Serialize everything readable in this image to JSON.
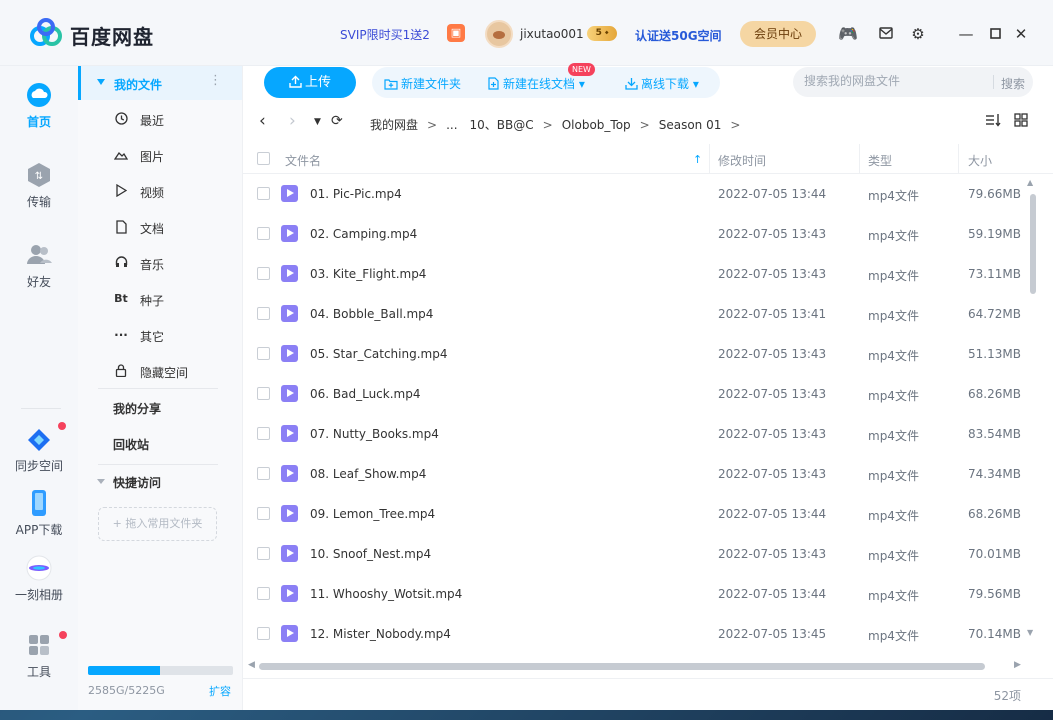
{
  "app": {
    "brand": "百度网盘"
  },
  "titlebar": {
    "promo": "SVIP限时买1送2",
    "username": "jixutao001",
    "vip_badge": "5",
    "verify": "认证送50G空间",
    "member_center": "会员中心"
  },
  "leftnav": {
    "items": [
      {
        "label": "首页",
        "icon": "home-cloud-icon"
      },
      {
        "label": "传输",
        "icon": "transfer-icon"
      },
      {
        "label": "好友",
        "icon": "friends-icon"
      },
      {
        "label": "同步空间",
        "icon": "sync-space-icon"
      },
      {
        "label": "APP下载",
        "icon": "phone-icon"
      },
      {
        "label": "一刻相册",
        "icon": "album-icon"
      },
      {
        "label": "工具",
        "icon": "tools-icon"
      }
    ]
  },
  "sidebar": {
    "my_files": "我的文件",
    "items": [
      {
        "label": "最近",
        "icon": "clock-icon"
      },
      {
        "label": "图片",
        "icon": "image-icon"
      },
      {
        "label": "视频",
        "icon": "play-icon"
      },
      {
        "label": "文档",
        "icon": "document-icon"
      },
      {
        "label": "音乐",
        "icon": "headphones-icon"
      },
      {
        "label": "种子",
        "icon": "torrent-icon"
      },
      {
        "label": "其它",
        "icon": "more-icon"
      },
      {
        "label": "隐藏空间",
        "icon": "lock-icon"
      }
    ],
    "my_share": "我的分享",
    "recycle": "回收站",
    "quick_access": "快捷访问",
    "drag_hint": "+ 拖入常用文件夹",
    "quota": "2585G/5225G",
    "quota_used_fraction": 0.495,
    "expand": "扩容"
  },
  "toolbar": {
    "upload": "上传",
    "new_folder": "新建文件夹",
    "new_doc": "新建在线文档",
    "new_badge": "NEW",
    "offline": "离线下载",
    "search_placeholder": "搜索我的网盘文件",
    "search_button": "搜索"
  },
  "breadcrumb": [
    "我的网盘",
    "...",
    "10、BB@C",
    "Olobob_Top",
    "Season 01"
  ],
  "table": {
    "headers": {
      "name": "文件名",
      "mtime": "修改时间",
      "type": "类型",
      "size": "大小"
    },
    "rows": [
      {
        "name": "01. Pic-Pic.mp4",
        "mtime": "2022-07-05 13:44",
        "type": "mp4文件",
        "size": "79.66MB"
      },
      {
        "name": "02. Camping.mp4",
        "mtime": "2022-07-05 13:43",
        "type": "mp4文件",
        "size": "59.19MB"
      },
      {
        "name": "03. Kite_Flight.mp4",
        "mtime": "2022-07-05 13:43",
        "type": "mp4文件",
        "size": "73.11MB"
      },
      {
        "name": "04. Bobble_Ball.mp4",
        "mtime": "2022-07-05 13:41",
        "type": "mp4文件",
        "size": "64.72MB"
      },
      {
        "name": "05. Star_Catching.mp4",
        "mtime": "2022-07-05 13:43",
        "type": "mp4文件",
        "size": "51.13MB"
      },
      {
        "name": "06. Bad_Luck.mp4",
        "mtime": "2022-07-05 13:43",
        "type": "mp4文件",
        "size": "68.26MB"
      },
      {
        "name": "07. Nutty_Books.mp4",
        "mtime": "2022-07-05 13:43",
        "type": "mp4文件",
        "size": "83.54MB"
      },
      {
        "name": "08. Leaf_Show.mp4",
        "mtime": "2022-07-05 13:43",
        "type": "mp4文件",
        "size": "74.34MB"
      },
      {
        "name": "09. Lemon_Tree.mp4",
        "mtime": "2022-07-05 13:44",
        "type": "mp4文件",
        "size": "68.26MB"
      },
      {
        "name": "10. Snoof_Nest.mp4",
        "mtime": "2022-07-05 13:43",
        "type": "mp4文件",
        "size": "70.01MB"
      },
      {
        "name": "11. Whooshy_Wotsit.mp4",
        "mtime": "2022-07-05 13:44",
        "type": "mp4文件",
        "size": "79.56MB"
      },
      {
        "name": "12. Mister_Nobody.mp4",
        "mtime": "2022-07-05 13:45",
        "type": "mp4文件",
        "size": "70.14MB"
      }
    ]
  },
  "footer": {
    "count": "52项"
  },
  "colors": {
    "accent": "#06a7ff",
    "video_icon": "#8b7ff5",
    "member": "#f5d6a3",
    "badge_red": "#f5425c"
  }
}
